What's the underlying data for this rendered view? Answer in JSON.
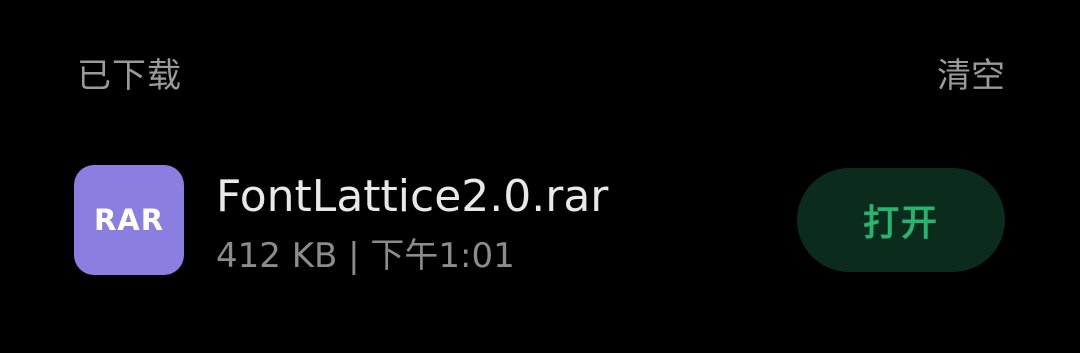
{
  "header": {
    "title": "已下载",
    "clear_label": "清空"
  },
  "download_item": {
    "icon_label": "RAR",
    "file_name": "FontLattice2.0.rar",
    "meta": "412 KB | 下午1:01",
    "open_label": "打开"
  },
  "colors": {
    "background": "#000000",
    "icon_background": "#8a7ee0",
    "open_button_background": "#0b2b1c",
    "open_button_text": "#27b46d",
    "primary_text": "#e8e8e8",
    "secondary_text": "#8c8c8c"
  }
}
